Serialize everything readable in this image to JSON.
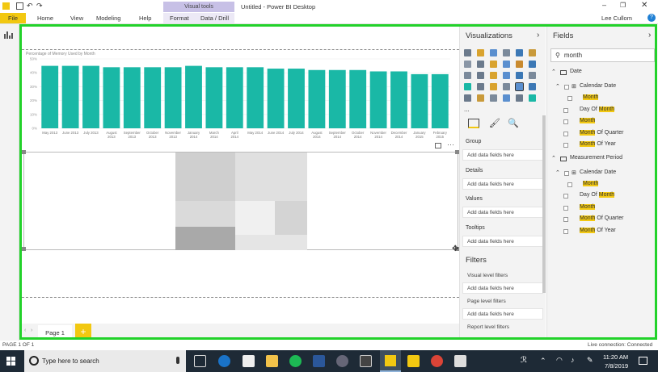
{
  "window": {
    "title": "Untitled - Power BI Desktop",
    "user": "Lee Cullom",
    "context_tab": "Visual tools"
  },
  "ribbon": {
    "tabs": [
      "File",
      "Home",
      "View",
      "Modeling",
      "Help",
      "Format",
      "Data / Drill"
    ]
  },
  "chart_data": {
    "type": "bar",
    "title": "Percentage of Memory Used by Month",
    "categories": [
      "May 2013",
      "June 2013",
      "July 2013",
      "August 2013",
      "September 2013",
      "October 2013",
      "November 2013",
      "January 2014",
      "March 2014",
      "April 2014",
      "May 2014",
      "June 2014",
      "July 2014",
      "August 2014",
      "September 2014",
      "October 2014",
      "November 2014",
      "December 2014",
      "January 2015",
      "February 2015"
    ],
    "values": [
      45,
      45,
      45,
      44,
      44,
      44,
      44,
      45,
      44,
      44,
      44,
      43,
      43,
      42,
      42,
      42,
      41,
      41,
      39,
      39
    ],
    "ylim": [
      0,
      50
    ],
    "ytick_labels": [
      "50%",
      "40%",
      "30%",
      "20%",
      "10%",
      "0%"
    ],
    "color": "#1ab8a6"
  },
  "visualizations": {
    "title": "Visualizations",
    "wells": [
      {
        "label": "Group",
        "placeholder": "Add data fields here"
      },
      {
        "label": "Details",
        "placeholder": "Add data fields here"
      },
      {
        "label": "Values",
        "placeholder": "Add data fields here"
      },
      {
        "label": "Tooltips",
        "placeholder": "Add data fields here"
      }
    ],
    "filters_title": "Filters",
    "filters": [
      {
        "label": "Visual level filters",
        "placeholder": "Add data fields here"
      },
      {
        "label": "Page level filters",
        "placeholder": "Add data fields here"
      },
      {
        "label": "Report level filters",
        "placeholder": ""
      }
    ]
  },
  "fields": {
    "title": "Fields",
    "search_value": "month",
    "tables": [
      {
        "name": "Date",
        "items": [
          {
            "pre": "",
            "hl": "Month",
            "post": ""
          },
          {
            "pre": "Day Of ",
            "hl": "Month",
            "post": ""
          },
          {
            "pre": "",
            "hl": "Month",
            "post": ""
          },
          {
            "pre": "",
            "hl": "Month",
            "post": " Of Quarter"
          },
          {
            "pre": "",
            "hl": "Month",
            "post": " Of Year"
          }
        ],
        "hierarchy": "Calendar Date"
      },
      {
        "name": "Measurement Period",
        "items": [
          {
            "pre": "",
            "hl": "Month",
            "post": ""
          },
          {
            "pre": "Day Of ",
            "hl": "Month",
            "post": ""
          },
          {
            "pre": "",
            "hl": "Month",
            "post": ""
          },
          {
            "pre": "",
            "hl": "Month",
            "post": " Of Quarter"
          },
          {
            "pre": "",
            "hl": "Month",
            "post": " Of Year"
          }
        ],
        "hierarchy": "Calendar Date"
      }
    ]
  },
  "pages": {
    "current": "Page 1",
    "status": "PAGE 1 OF 1",
    "connection": "Live connection: Connected"
  },
  "taskbar": {
    "search_placeholder": "Type here to search",
    "time": "11:20 AM",
    "date": "7/8/2019"
  }
}
